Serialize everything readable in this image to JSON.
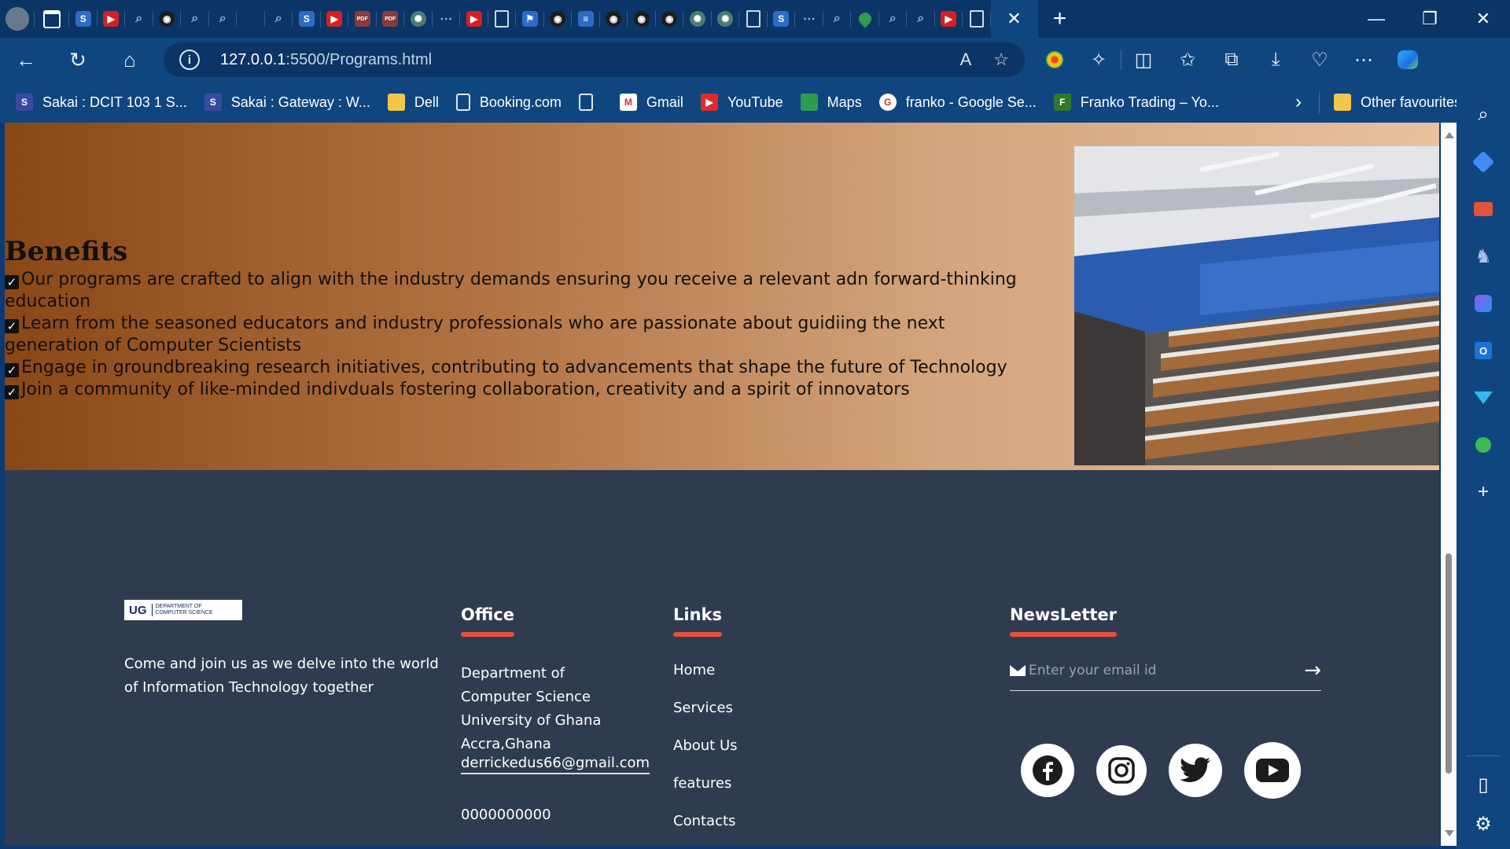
{
  "browser": {
    "url_host": "127.0.0.1",
    "url_path": ":5500/Programs.html",
    "read_aloud_label": "A",
    "tabs": [
      {
        "icon": "sakai-icon"
      },
      {
        "icon": "youtube-icon"
      },
      {
        "icon": "search-icon"
      },
      {
        "icon": "github-icon"
      },
      {
        "icon": "search-icon"
      },
      {
        "icon": "search-icon"
      },
      {
        "icon": "blank-icon"
      },
      {
        "icon": "search-icon"
      },
      {
        "icon": "sakai-icon"
      },
      {
        "icon": "youtube-icon"
      },
      {
        "icon": "pdf-icon"
      },
      {
        "icon": "pdf-icon"
      },
      {
        "icon": "chatgpt-icon"
      },
      {
        "icon": "ellipsis-icon"
      },
      {
        "icon": "youtube-icon"
      },
      {
        "icon": "document-icon"
      },
      {
        "icon": "flag-icon"
      },
      {
        "icon": "github-icon"
      },
      {
        "icon": "docs-icon"
      },
      {
        "icon": "github-icon"
      },
      {
        "icon": "github-icon"
      },
      {
        "icon": "github-icon"
      },
      {
        "icon": "chatgpt-icon"
      },
      {
        "icon": "chatgpt-icon"
      },
      {
        "icon": "document-icon"
      },
      {
        "icon": "sakai-icon"
      },
      {
        "icon": "ellipsis-icon"
      },
      {
        "icon": "search-icon"
      },
      {
        "icon": "maps-icon"
      },
      {
        "icon": "search-icon"
      },
      {
        "icon": "search-icon"
      },
      {
        "icon": "youtube-icon"
      },
      {
        "icon": "document-icon"
      }
    ],
    "bookmarks": [
      {
        "label": "Sakai : DCIT 103 1 S...",
        "icon": "sakai-icon"
      },
      {
        "label": "Sakai : Gateway : W...",
        "icon": "sakai-icon"
      },
      {
        "label": "Dell",
        "icon": "folder-icon"
      },
      {
        "label": "Booking.com",
        "icon": "document-icon"
      },
      {
        "label": "",
        "icon": "document-icon"
      },
      {
        "label": "Gmail",
        "icon": "gmail-icon"
      },
      {
        "label": "YouTube",
        "icon": "youtube-icon"
      },
      {
        "label": "Maps",
        "icon": "maps-icon"
      },
      {
        "label": "franko - Google Se...",
        "icon": "google-icon"
      },
      {
        "label": "Franko Trading – Yo...",
        "icon": "franko-icon"
      }
    ],
    "other_favourites": "Other favourites"
  },
  "benefits": {
    "title": "Benefits",
    "items": [
      "Our programs are crafted to align with the industry demands ensuring you receive a relevant adn forward-thinking education",
      "Learn from the seasoned educators and industry professionals who are passionate about guidiing the next generation of Computer Scientists",
      "Engage in groundbreaking research initiatives, contributing to advancements that shape the future of Technology",
      "Join a community of like-minded indivduals fostering collaboration, creativity and a spirit of innovators"
    ]
  },
  "footer": {
    "logo": {
      "short": "UG",
      "dept_line1": "DEPARTMENT OF",
      "dept_line2": "COMPUTER SCIENCE"
    },
    "about": "Come and join us as we delve into the world of Information Technology together",
    "office": {
      "heading": "Office",
      "line1": "Department of Computer Science",
      "line2": "University of Ghana",
      "line3": "Accra,Ghana",
      "email": "derrickedus66@gmail.com",
      "phone": "0000000000"
    },
    "links": {
      "heading": "Links",
      "items": [
        "Home",
        "Services",
        "About Us",
        "features",
        "Contacts"
      ]
    },
    "newsletter": {
      "heading": "NewsLetter",
      "placeholder": "Enter your email id"
    },
    "socials": [
      "facebook-icon",
      "instagram-icon",
      "twitter-icon",
      "youtube-icon"
    ]
  },
  "colors": {
    "accent": "#e8503a",
    "footer_bg": "#2f3c50",
    "chrome_bg": "#0f4680"
  }
}
